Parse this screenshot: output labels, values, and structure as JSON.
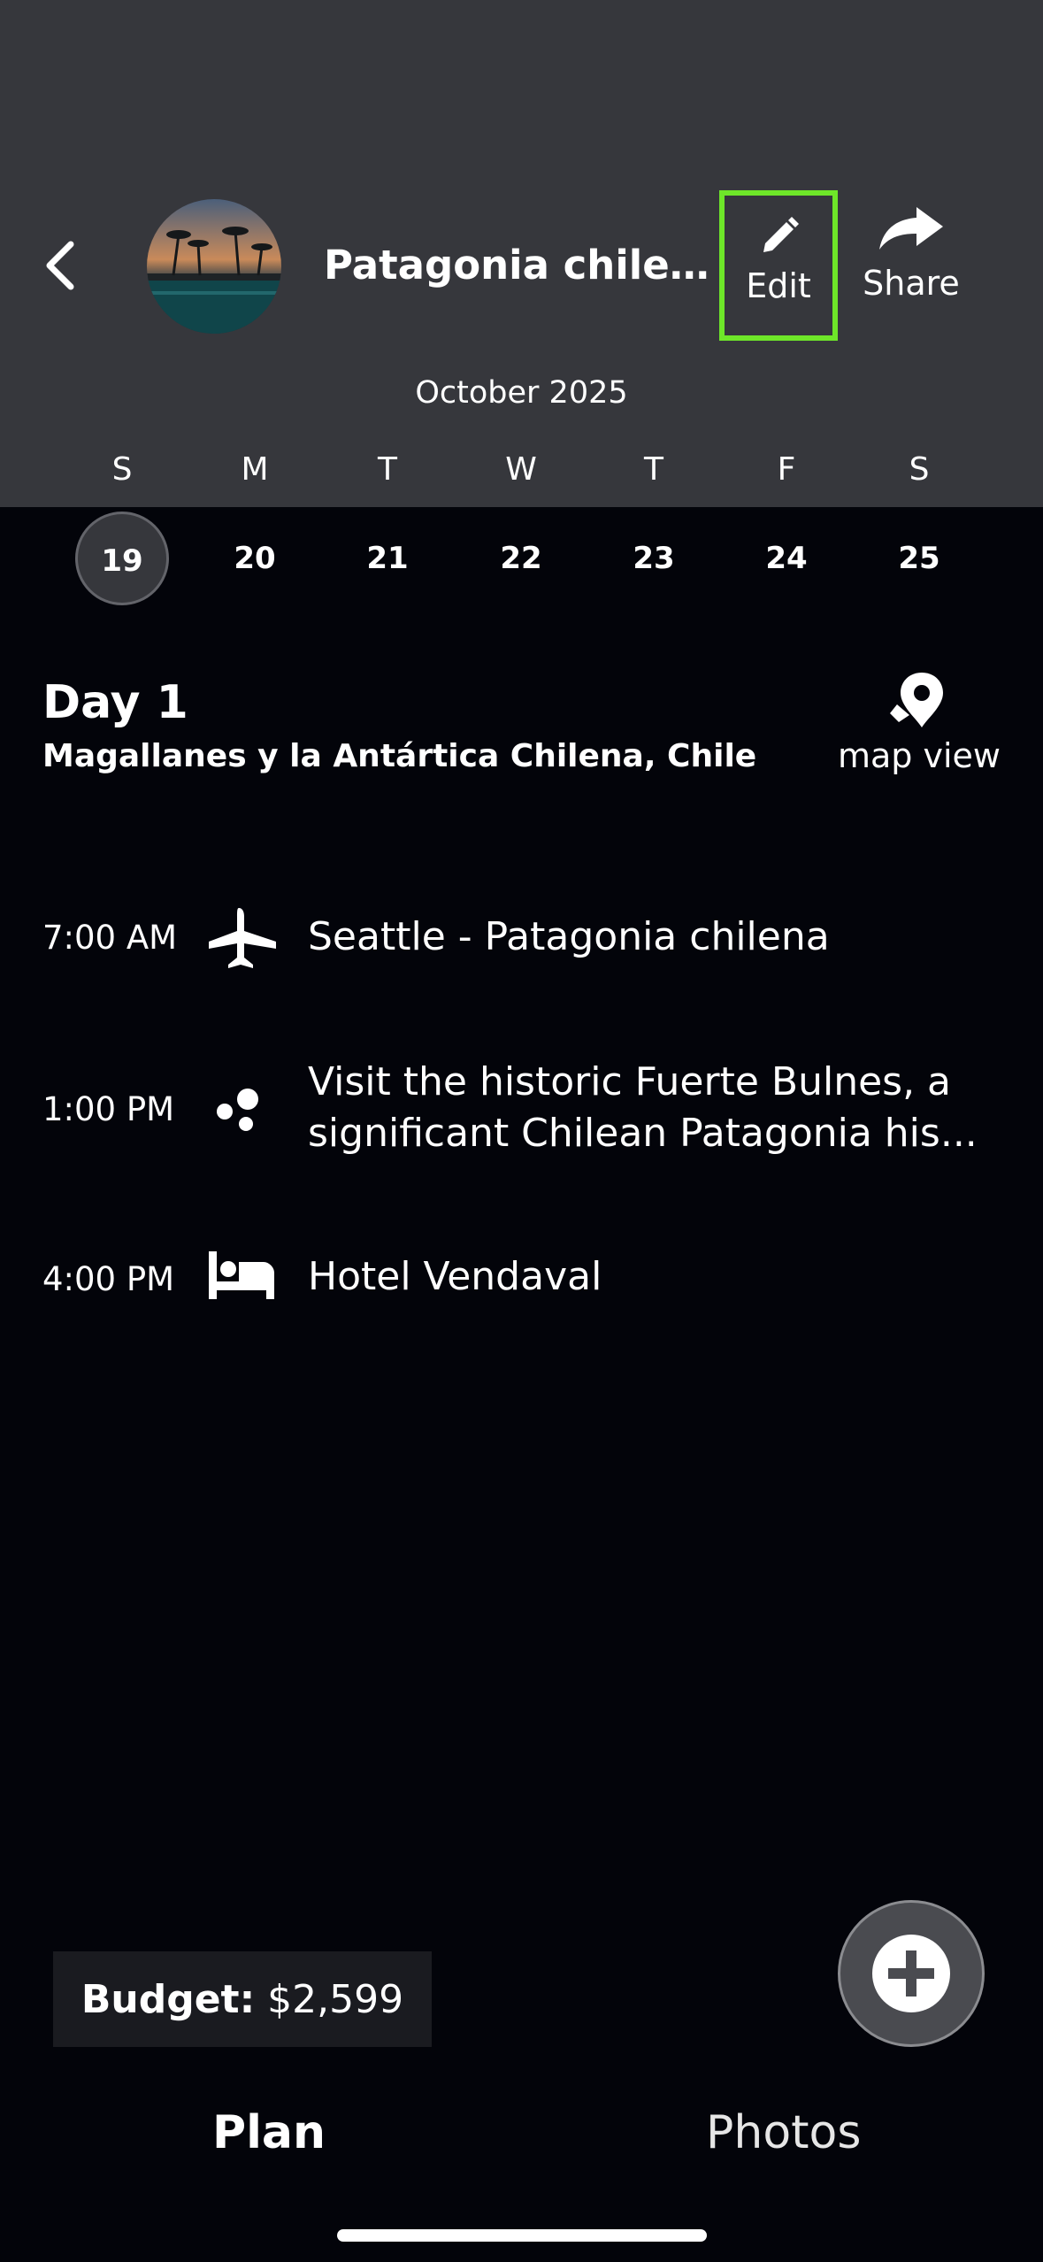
{
  "header": {
    "trip_title": "Patagonia chilen...",
    "edit_label": "Edit",
    "share_label": "Share"
  },
  "calendar": {
    "month": "October 2025",
    "weekdays": [
      "S",
      "M",
      "T",
      "W",
      "T",
      "F",
      "S"
    ],
    "dates": [
      "19",
      "20",
      "21",
      "22",
      "23",
      "24",
      "25"
    ],
    "selected_date": "19"
  },
  "day": {
    "title": "Day 1",
    "location": "Magallanes y la Antártica Chilena, Chile",
    "map_view_label": "map view"
  },
  "itinerary": [
    {
      "time": "7:00 AM",
      "icon": "airplane-icon",
      "text": "Seattle - Patagonia chilena"
    },
    {
      "time": "1:00 PM",
      "icon": "activity-dots-icon",
      "text": "Visit the historic Fuerte Bulnes, a significant Chilean Patagonia his..."
    },
    {
      "time": "4:00 PM",
      "icon": "bed-icon",
      "text": "Hotel Vendaval"
    }
  ],
  "budget": {
    "label": "Budget:",
    "value": "$2,599"
  },
  "tabs": {
    "plan": "Plan",
    "photos": "Photos"
  },
  "colors": {
    "header_bg": "#36373c",
    "page_bg": "#03040a",
    "highlight": "#6ee629"
  }
}
